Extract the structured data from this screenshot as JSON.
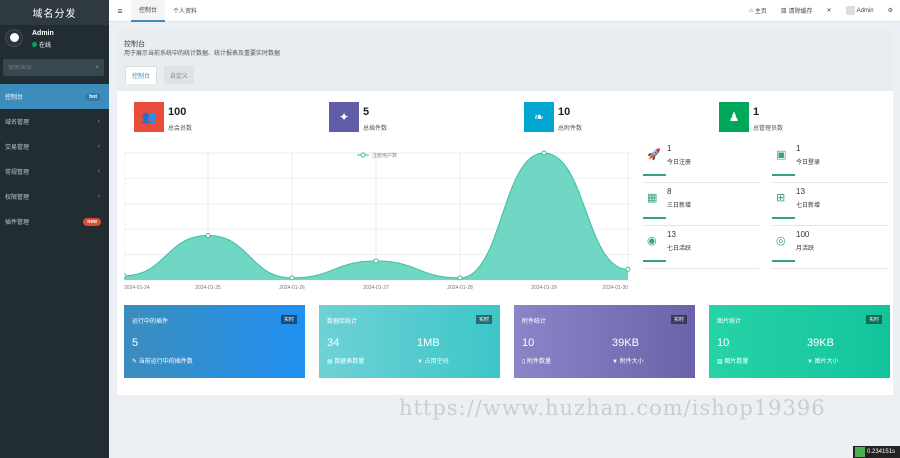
{
  "sidebar": {
    "logo": "域名分发",
    "user": {
      "name": "Admin",
      "status": "在线"
    },
    "search_placeholder": "搜索菜单",
    "menu": [
      {
        "label": "控制台",
        "badge": "hot",
        "active": true
      },
      {
        "label": "域名管理",
        "arrow": "‹"
      },
      {
        "label": "交易管理",
        "arrow": "‹"
      },
      {
        "label": "常规管理",
        "arrow": "‹"
      },
      {
        "label": "权限管理",
        "arrow": "‹"
      },
      {
        "label": "插件管理",
        "badge": "new"
      }
    ]
  },
  "topbar": {
    "menu_icon": "≡",
    "tabs": [
      "控制台",
      "个人资料"
    ],
    "right": {
      "home": "主页",
      "clear_cache": "清除缓存",
      "user": "Admin"
    }
  },
  "panel": {
    "title": "控制台",
    "description": "用于展示当前系统中的统计数据、统计报表及重要实时数据",
    "tabs": [
      "控制台",
      "自定义"
    ]
  },
  "stats": [
    {
      "value": "100",
      "label": "总会员数",
      "color": "#e74c3c",
      "icon": "users-icon"
    },
    {
      "value": "5",
      "label": "总插件数",
      "color": "#605ca8",
      "icon": "magic-icon"
    },
    {
      "value": "10",
      "label": "总附件数",
      "color": "#00a7d0",
      "icon": "leaf-icon"
    },
    {
      "value": "1",
      "label": "总管理员数",
      "color": "#00a65a",
      "icon": "user-icon"
    }
  ],
  "chart_data": {
    "type": "area",
    "legend": "注册用户数",
    "x_labels": [
      "2024-01-24",
      "2024-01-25",
      "2024-01-26",
      "2024-01-27",
      "2024-01-28",
      "2024-01-29",
      "2024-01-30"
    ],
    "values": [
      2,
      21,
      1,
      9,
      1,
      60,
      5
    ],
    "color": "#5fd3bc"
  },
  "mini_stats": [
    {
      "value": "1",
      "label": "今日注册",
      "icon": "rocket-icon"
    },
    {
      "value": "1",
      "label": "今日登录",
      "icon": "vcard-icon"
    },
    {
      "value": "8",
      "label": "三日新增",
      "icon": "calendar-icon"
    },
    {
      "value": "13",
      "label": "七日新增",
      "icon": "calendar-plus-icon"
    },
    {
      "value": "13",
      "label": "七日活跃",
      "icon": "user-circle-icon"
    },
    {
      "value": "100",
      "label": "月活跃",
      "icon": "user-circle-o-icon"
    }
  ],
  "cards": [
    {
      "title": "运行中的插件",
      "tag": "实时",
      "v1": "5",
      "l1": "当前运行中的插件数",
      "v2": "",
      "l2": "",
      "c1": "#3c8dbc",
      "c2": "#1f8ff0"
    },
    {
      "title": "数据库统计",
      "tag": "实时",
      "v1": "34",
      "l1": "数据表数量",
      "v2": "1MB",
      "l2": "占用空间",
      "c1": "#6fd1d6",
      "c2": "#3cc6c8"
    },
    {
      "title": "附件统计",
      "tag": "实时",
      "v1": "10",
      "l1": "附件数量",
      "v2": "39KB",
      "l2": "附件大小",
      "c1": "#8b85c8",
      "c2": "#6a63a9"
    },
    {
      "title": "图片统计",
      "tag": "实时",
      "v1": "10",
      "l1": "图片数量",
      "v2": "39KB",
      "l2": "图片大小",
      "c1": "#27d3a9",
      "c2": "#13c49a"
    }
  ],
  "watermark": "https://www.huzhan.com/ishop19396",
  "corner_text": "0.234151s"
}
